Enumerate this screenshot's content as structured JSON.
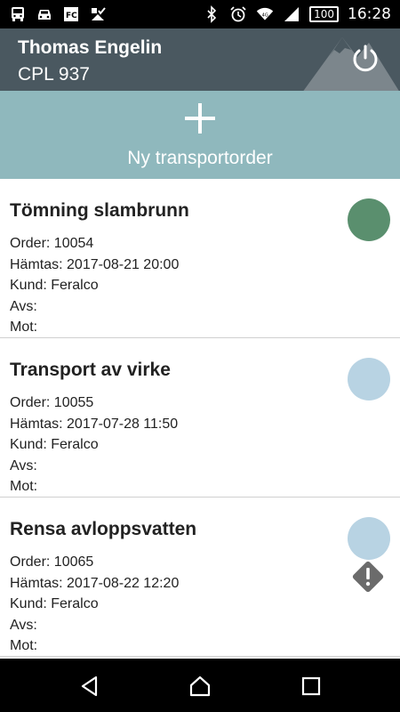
{
  "status_bar": {
    "time": "16:28",
    "battery": "100",
    "left_icons": [
      "bus-icon",
      "car-icon",
      "fc-app-icon",
      "checklist-icon"
    ],
    "right_icons": [
      "bluetooth-icon",
      "alarm-icon",
      "wifi-icon",
      "signal-icon"
    ]
  },
  "header": {
    "user_name": "Thomas Engelin",
    "vehicle": "CPL 937"
  },
  "new_order": {
    "label": "Ny transportorder"
  },
  "orders": [
    {
      "title": "Tömning slambrunn",
      "order": "Order: 10054",
      "pickup": "Hämtas: 2017-08-21 20:00",
      "customer": "Kund: Feralco",
      "from": "Avs:",
      "to": "Mot:",
      "status_color": "#5a8f6e",
      "warning": false
    },
    {
      "title": "Transport av virke",
      "order": "Order: 10055",
      "pickup": "Hämtas: 2017-07-28 11:50",
      "customer": "Kund: Feralco",
      "from": "Avs:",
      "to": "Mot:",
      "status_color": "#b8d3e3",
      "warning": false
    },
    {
      "title": "Rensa avloppsvatten",
      "order": "Order: 10065",
      "pickup": "Hämtas: 2017-08-22 12:20",
      "customer": "Kund: Feralco",
      "from": "Avs:",
      "to": "Mot:",
      "status_color": "#b8d3e3",
      "warning": true
    }
  ],
  "colors": {
    "header_bg": "#4a5860",
    "new_order_bg": "#8fb8bd",
    "status_done": "#5a8f6e",
    "status_pending": "#b8d3e3",
    "warning": "#6b6b6b"
  }
}
